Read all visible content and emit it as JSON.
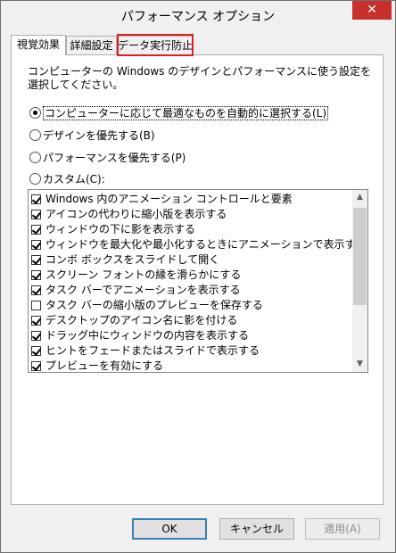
{
  "window": {
    "title": "パフォーマンス オプション",
    "close_glyph": "✕"
  },
  "tabs": [
    {
      "label": "視覚効果",
      "selected": true
    },
    {
      "label": "詳細設定",
      "selected": false
    },
    {
      "label": "データ実行防止",
      "selected": false,
      "highlighted": true
    }
  ],
  "description": "コンピューターの Windows のデザインとパフォーマンスに使う設定を選択してください。",
  "radios": [
    {
      "label": "コンピューターに応じて最適なものを自動的に選択する(L)",
      "checked": true
    },
    {
      "label": "デザインを優先する(B)",
      "checked": false
    },
    {
      "label": "パフォーマンスを優先する(P)",
      "checked": false
    },
    {
      "label": "カスタム(C):",
      "checked": false
    }
  ],
  "effects": [
    {
      "label": "Windows 内のアニメーション コントロールと要素",
      "checked": true
    },
    {
      "label": "アイコンの代わりに縮小版を表示する",
      "checked": true
    },
    {
      "label": "ウィンドウの下に影を表示する",
      "checked": true
    },
    {
      "label": "ウィンドウを最大化や最小化するときにアニメーションで表示する",
      "checked": true
    },
    {
      "label": "コンボ ボックスをスライドして開く",
      "checked": true
    },
    {
      "label": "スクリーン フォントの縁を滑らかにする",
      "checked": true
    },
    {
      "label": "タスク バーでアニメーションを表示する",
      "checked": true
    },
    {
      "label": "タスク バーの縮小版のプレビューを保存する",
      "checked": false
    },
    {
      "label": "デスクトップのアイコン名に影を付ける",
      "checked": true
    },
    {
      "label": "ドラッグ中にウィンドウの内容を表示する",
      "checked": true
    },
    {
      "label": "ヒントをフェードまたはスライドで表示する",
      "checked": true
    },
    {
      "label": "プレビューを有効にする",
      "checked": true
    }
  ],
  "scrollbar": {
    "up_glyph": "▲",
    "down_glyph": "▼"
  },
  "buttons": {
    "ok": "OK",
    "cancel": "キャンセル",
    "apply": "適用(A)"
  },
  "colors": {
    "close_button": "#c7302b",
    "tab_highlight": "#e02020"
  }
}
